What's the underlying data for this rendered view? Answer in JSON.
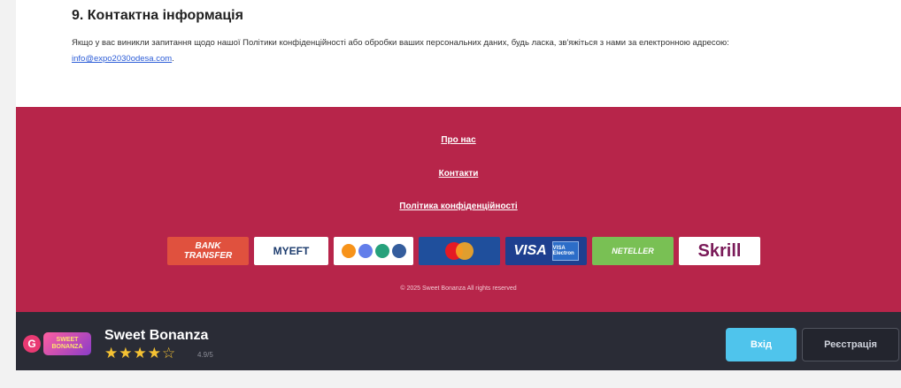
{
  "section": {
    "title": "9. Контактна інформація",
    "text": "Якщо у вас виникли запитання щодо нашої Політики конфіденційності або обробки ваших персональних даних, будь ласка, зв'яжіться з нами за електронною адресою:",
    "email": "info@expo2030odesa.com",
    "text_end": "."
  },
  "footer": {
    "links": [
      "Про нас",
      "Контакти",
      "Політика конфіденційності"
    ],
    "payments": {
      "bank_line1": "BANK",
      "bank_line2": "TRANSFER",
      "myeft": "MYEFT",
      "visa": "VISA",
      "visa_card": "VISA Electron",
      "neteller": "NETELLER",
      "skrill": "Skrill"
    },
    "copyright": "© 2025 Sweet Bonanza All rights reserved"
  },
  "appbar": {
    "logo_g": "G",
    "logo_text": "SWEET BONANZA",
    "app_name": "Sweet Bonanza",
    "stars": "★★★★☆",
    "rating": "4.9/5",
    "login_label": "Вхід",
    "register_label": "Реєстрація"
  },
  "colors": {
    "footer_bg": "#b7254a",
    "appbar_bg": "#2a2c36",
    "login_btn": "#4fc4ec",
    "star": "#f5c233"
  }
}
